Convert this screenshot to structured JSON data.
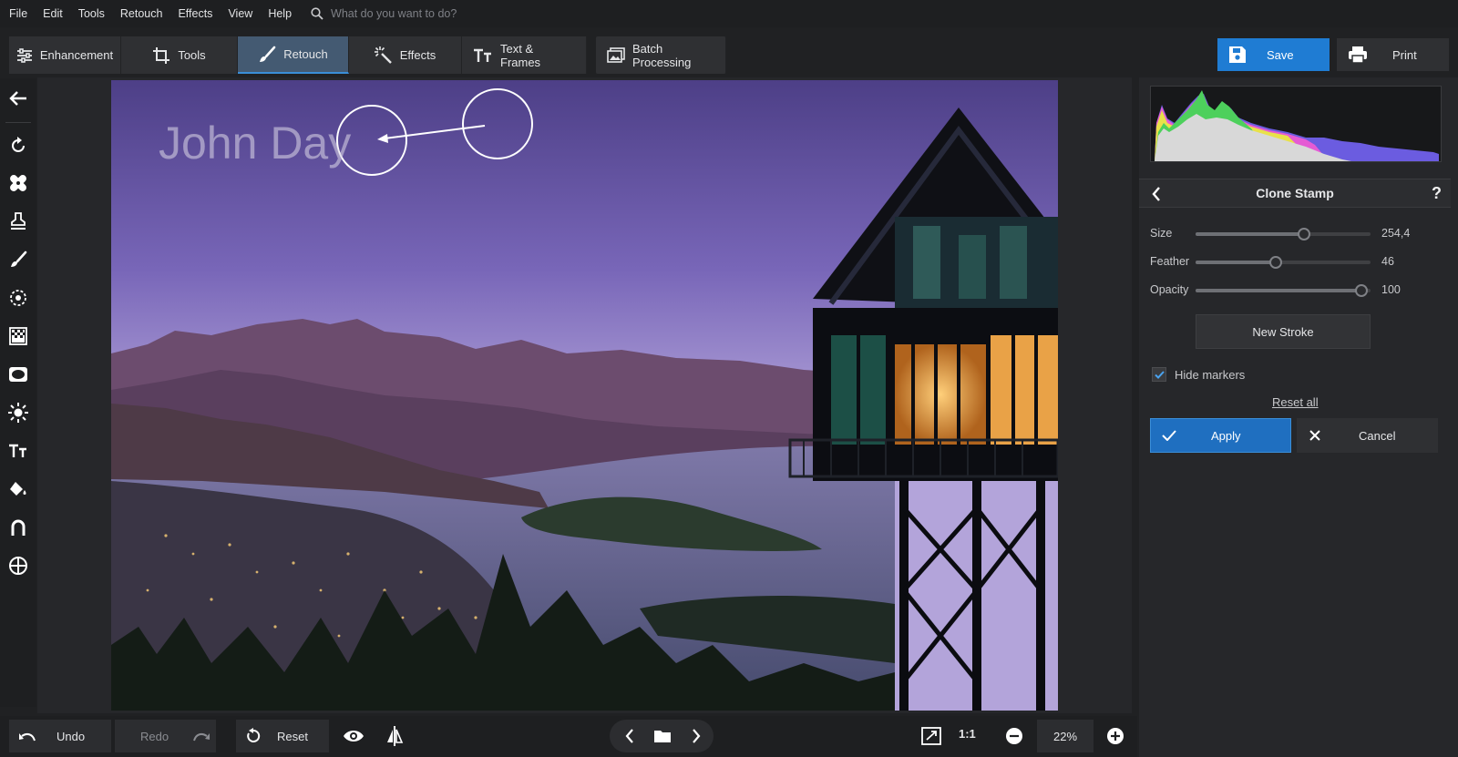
{
  "menu": {
    "items": [
      "File",
      "Edit",
      "Tools",
      "Retouch",
      "Effects",
      "View",
      "Help"
    ],
    "search_placeholder": "What do you want to do?"
  },
  "tabs": {
    "enhancement": "Enhancement",
    "tools": "Tools",
    "retouch": "Retouch",
    "effects": "Effects",
    "text_frames": "Text & Frames",
    "batch": "Batch Processing",
    "active": "Retouch"
  },
  "actions": {
    "save": "Save",
    "print": "Print"
  },
  "photo": {
    "watermark": "John Day"
  },
  "panel": {
    "title": "Clone Stamp",
    "help": "?",
    "sliders": [
      {
        "label": "Size",
        "value": "254,4",
        "fraction": 0.62
      },
      {
        "label": "Feather",
        "value": "46",
        "fraction": 0.46
      },
      {
        "label": "Opacity",
        "value": "100",
        "fraction": 0.95
      }
    ],
    "new_stroke": "New Stroke",
    "hide_markers": {
      "label": "Hide markers",
      "checked": true
    },
    "reset_all": "Reset all",
    "apply": "Apply",
    "cancel": "Cancel"
  },
  "bottom": {
    "undo": "Undo",
    "redo": "Redo",
    "reset": "Reset",
    "one_to_one": "1:1",
    "zoom": "22%"
  },
  "colors": {
    "accent": "#1f7cd3",
    "active_tab": "#445a72",
    "panel_bg": "#26272a"
  }
}
